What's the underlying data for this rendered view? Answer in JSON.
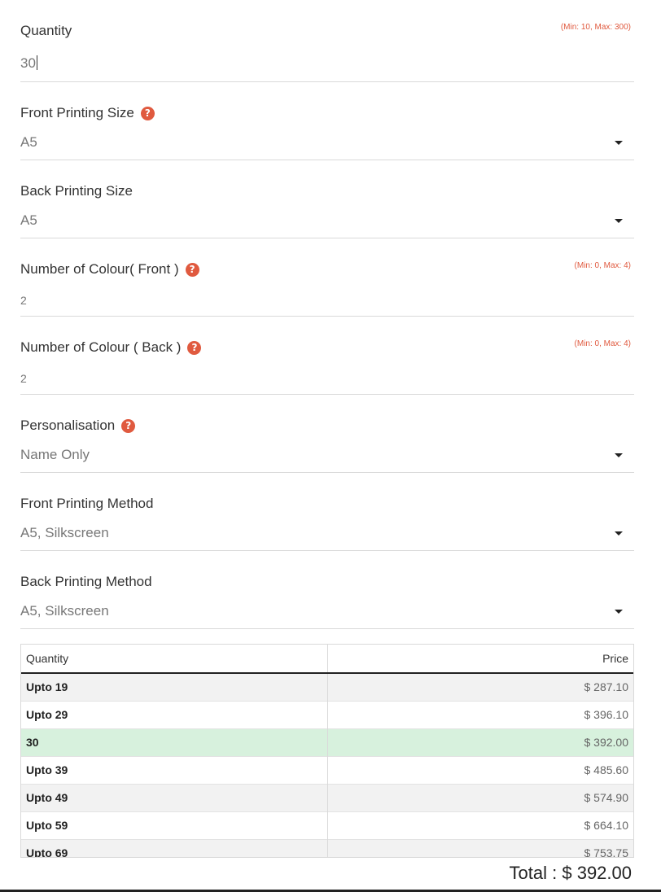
{
  "header_fragment": "",
  "fields": [
    {
      "label": "Quantity",
      "value": "30",
      "range": "(Min: 10, Max: 300)",
      "type": "input"
    },
    {
      "label": "Front Printing Size",
      "value": "A5",
      "type": "select",
      "help": true
    },
    {
      "label": "Back Printing Size",
      "value": "A5",
      "type": "select"
    },
    {
      "label": "Number of Colour( Front )",
      "value": "2",
      "range": "(Min: 0, Max: 4)",
      "type": "input",
      "help": true
    },
    {
      "label": "Number of Colour ( Back )",
      "value": "2",
      "range": "(Min: 0, Max: 4)",
      "type": "input",
      "help": true
    },
    {
      "label": "Personalisation",
      "value": "Name Only",
      "type": "select",
      "help": true
    },
    {
      "label": "Front Printing Method",
      "value": "A5, Silkscreen",
      "type": "select"
    },
    {
      "label": "Back Printing Method",
      "value": "A5, Silkscreen",
      "type": "select"
    }
  ],
  "price_table": {
    "headers": {
      "quantity": "Quantity",
      "price": "Price"
    },
    "rows": [
      {
        "q": "Upto 19",
        "p": "$ 287.10"
      },
      {
        "q": "Upto 29",
        "p": "$ 396.10"
      },
      {
        "q": "30",
        "p": "$ 392.00",
        "active": true
      },
      {
        "q": "Upto 39",
        "p": "$ 485.60"
      },
      {
        "q": "Upto 49",
        "p": "$ 574.90"
      },
      {
        "q": "Upto 59",
        "p": "$ 664.10"
      },
      {
        "q": "Upto 69",
        "p": "$ 753.75"
      }
    ]
  },
  "total": "Total : $ 392.00",
  "colors": {
    "accent": "#e05a3f",
    "active_row": "#d7f1dd"
  }
}
